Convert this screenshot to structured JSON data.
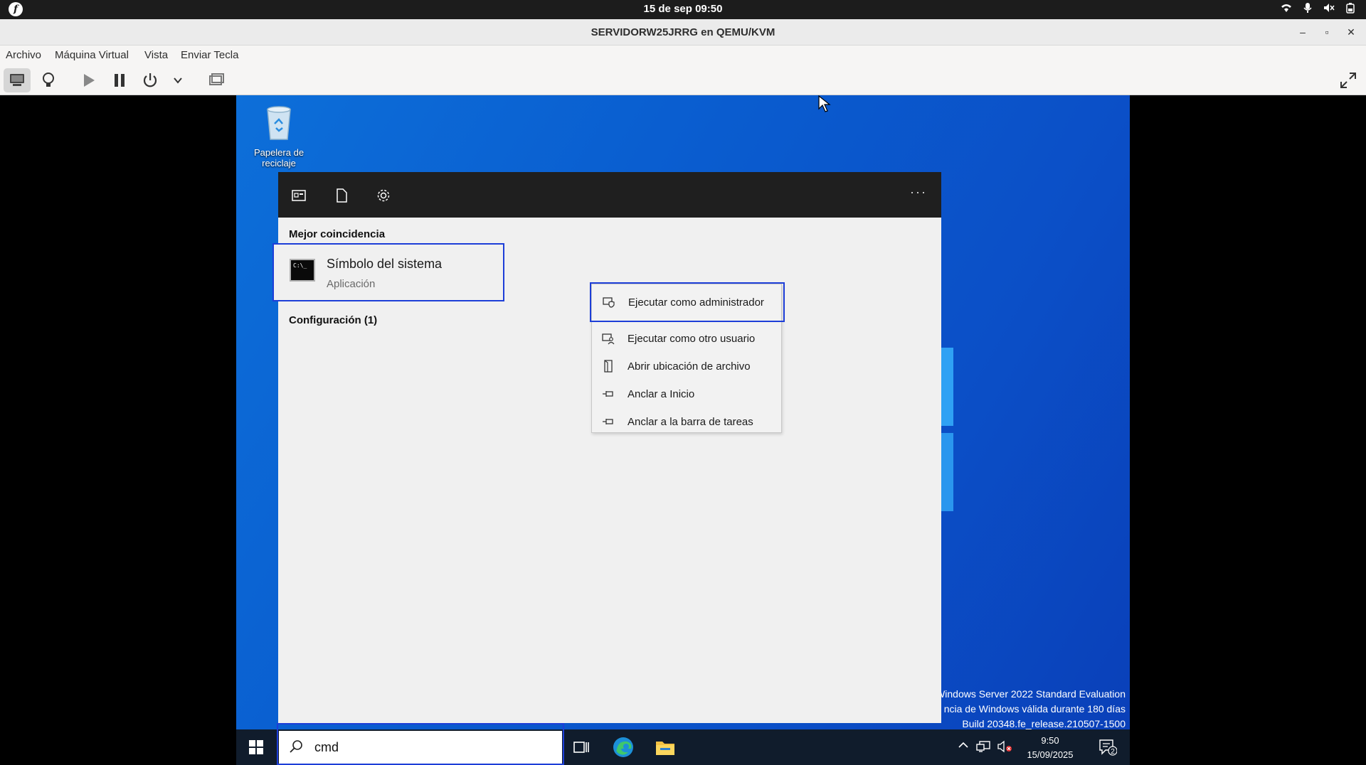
{
  "topbar": {
    "clock": "15 de sep  09:50"
  },
  "window": {
    "title": "SERVIDORW25JRRG en QEMU/KVM"
  },
  "menubar": {
    "items": [
      "Archivo",
      "Máquina Virtual",
      "Vista",
      "Enviar Tecla"
    ]
  },
  "desktop": {
    "recycle_bin": {
      "line1": "Papelera de",
      "line2": "reciclaje"
    },
    "watermark": [
      "Windows Server 2022 Standard Evaluation",
      "ncia de Windows válida durante 180 días",
      "Build 20348.fe_release.210507-1500"
    ]
  },
  "search_panel": {
    "best_match_title": "Mejor coincidencia",
    "best_match": {
      "name": "Símbolo del sistema",
      "type": "Aplicación",
      "icon_text": "C:\\_"
    },
    "settings_title": "Configuración (1)",
    "more": "···"
  },
  "context_menu": {
    "items": [
      {
        "label": "Ejecutar como administrador",
        "icon": "shield-icon"
      },
      {
        "label": "Ejecutar como otro usuario",
        "icon": "user-icon"
      },
      {
        "label": "Abrir ubicación de archivo",
        "icon": "file-location-icon"
      },
      {
        "label": "Anclar a Inicio",
        "icon": "pin-icon"
      },
      {
        "label": "Anclar a la barra de tareas",
        "icon": "pin-icon"
      }
    ]
  },
  "taskbar": {
    "search_value": "cmd",
    "time": "9:50",
    "date": "15/09/2025",
    "notification_count": "2"
  },
  "colors": {
    "selection_border": "#1d3ed8",
    "desktop_blue": "#0a5ed0",
    "taskbar": "#101c2c"
  }
}
